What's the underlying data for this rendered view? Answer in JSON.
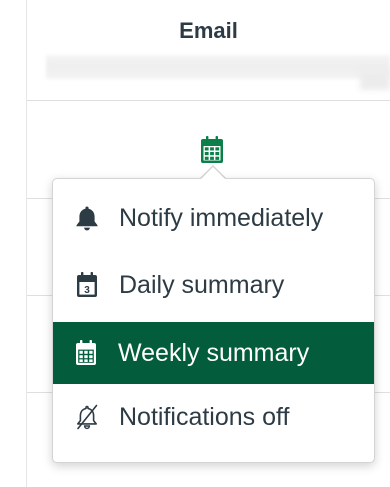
{
  "header": {
    "column_label": "Email"
  },
  "cell": {
    "selected_icon": "calendar-week-icon",
    "icon_color": "#0b7f4a"
  },
  "menu": {
    "items": [
      {
        "label": "Notify immediately",
        "icon": "bell-icon",
        "selected": false
      },
      {
        "label": "Daily summary",
        "icon": "calendar-day-icon",
        "day_number": "3",
        "selected": false
      },
      {
        "label": "Weekly summary",
        "icon": "calendar-week-icon",
        "selected": true
      },
      {
        "label": "Notifications off",
        "icon": "bell-off-icon",
        "selected": false
      }
    ],
    "selected_background": "#035c3b",
    "text_color": "#2d3b45"
  }
}
